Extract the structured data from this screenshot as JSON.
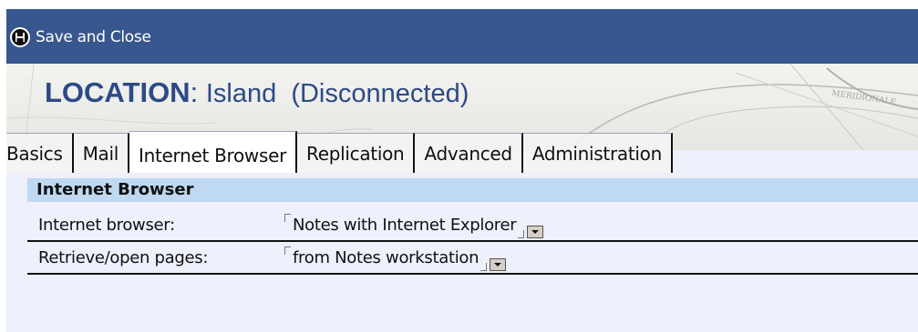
{
  "action_bar": {
    "save_close_label": "Save and Close",
    "background_color": "#37578e"
  },
  "header": {
    "keyword": "LOCATION",
    "separator": ":",
    "name": "Island  (Disconnected)",
    "title_color": "#2c4a86"
  },
  "tabs": [
    {
      "label": "Basics",
      "active": false
    },
    {
      "label": "Mail",
      "active": false
    },
    {
      "label": "Internet Browser",
      "active": true
    },
    {
      "label": "Replication",
      "active": false
    },
    {
      "label": "Advanced",
      "active": false
    },
    {
      "label": "Administration",
      "active": false
    }
  ],
  "section": {
    "title": "Internet Browser",
    "header_color": "#bfd9f2",
    "fields": [
      {
        "label": "Internet browser:",
        "value": "Notes with Internet Explorer",
        "control": "dropdown"
      },
      {
        "label": "Retrieve/open pages:",
        "value": "from Notes workstation",
        "control": "dropdown"
      }
    ]
  },
  "icons": {
    "save": "floppy-disk-icon",
    "dropdown": "dropdown-arrow-icon"
  }
}
